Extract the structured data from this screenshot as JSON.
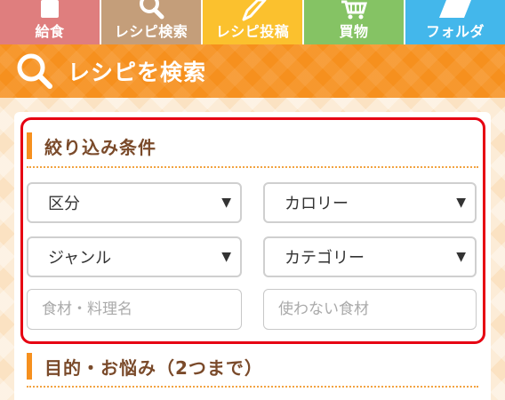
{
  "nav": {
    "tabs": [
      {
        "label": "給食",
        "color": "#df7e7e",
        "icon": "book-icon"
      },
      {
        "label": "レシピ検索",
        "color": "#c49e7a",
        "icon": "search-icon"
      },
      {
        "label": "レシピ投稿",
        "color": "#fbc12e",
        "icon": "pencil-icon"
      },
      {
        "label": "買物",
        "color": "#85c364",
        "icon": "cart-icon"
      },
      {
        "label": "フォルダ",
        "color": "#43b7eb",
        "icon": "folder-icon"
      }
    ]
  },
  "titlebar": {
    "title": "レシピを検索",
    "color": "#f6901e"
  },
  "filter": {
    "heading": "絞り込み条件",
    "selects": [
      {
        "value": "区分",
        "arrow": "▼"
      },
      {
        "value": "カロリー",
        "arrow": "▼"
      },
      {
        "value": "ジャンル",
        "arrow": "▼"
      },
      {
        "value": "カテゴリー",
        "arrow": "▼"
      }
    ],
    "ingredient_placeholder": "食材・料理名",
    "exclude_placeholder": "使わない食材"
  },
  "purpose": {
    "heading": "目的・お悩み（2つまで）"
  },
  "colors": {
    "accent": "#f6901e",
    "highlight": "#e60012",
    "heading_text": "#7a4a2a"
  }
}
